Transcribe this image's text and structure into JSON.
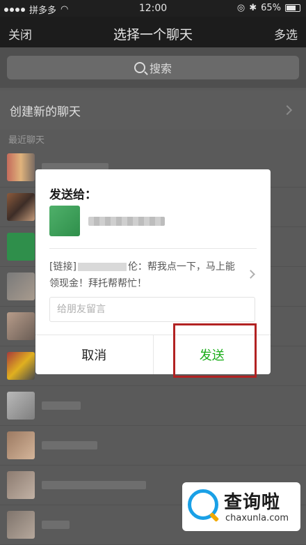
{
  "status_bar": {
    "carrier": "拼多多",
    "time": "12:00",
    "battery": "65%"
  },
  "nav": {
    "close": "关闭",
    "title": "选择一个聊天",
    "multi_select": "多选"
  },
  "search": {
    "placeholder": "搜索"
  },
  "new_chat": {
    "label": "创建新的聊天"
  },
  "recent": {
    "label": "最近聊天"
  },
  "dialog": {
    "title": "发送给：",
    "message": "[链接]",
    "message_rest": "伦：帮我点一下，马上能领现金！拜托帮帮忙！",
    "input_placeholder": "给朋友留言",
    "cancel": "取消",
    "send": "发送"
  },
  "watermark": {
    "cn": "查询啦",
    "en": "chaxunla.com"
  },
  "colors": {
    "send_green": "#1aad19",
    "highlight_red": "#b22222"
  }
}
